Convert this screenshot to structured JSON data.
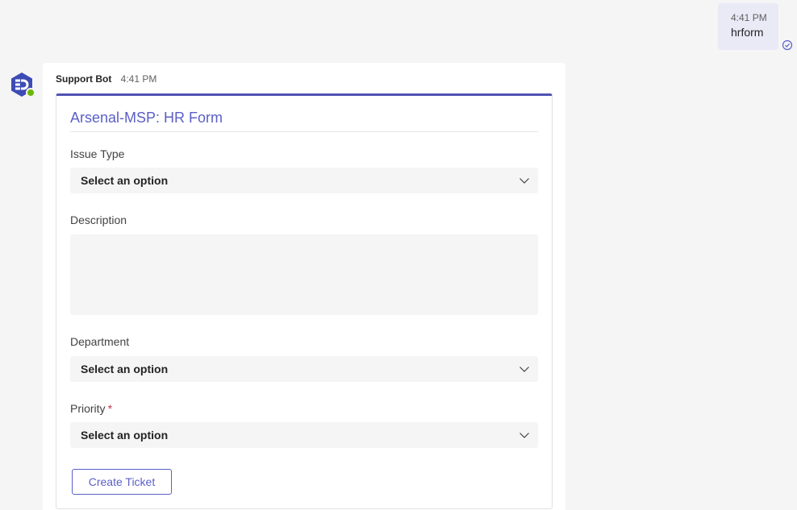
{
  "user_message": {
    "time": "4:41 PM",
    "text": "hrform"
  },
  "bot_message": {
    "sender": "Support Bot",
    "time": "4:41 PM",
    "avatar_icon": "bot-logo-icon",
    "presence": "available"
  },
  "card": {
    "title": "Arsenal-MSP: HR Form",
    "fields": {
      "issue_type": {
        "label": "Issue Type",
        "value": "Select an option"
      },
      "description": {
        "label": "Description",
        "value": ""
      },
      "department": {
        "label": "Department",
        "value": "Select an option"
      },
      "priority": {
        "label": "Priority",
        "required_mark": "*",
        "value": "Select an option"
      }
    },
    "submit_label": "Create Ticket"
  },
  "colors": {
    "accent": "#5b5fc7",
    "card_top_border": "#4f52b2",
    "user_bubble": "#e9eaf6",
    "required": "#c4314b",
    "presence": "#6bb700"
  }
}
